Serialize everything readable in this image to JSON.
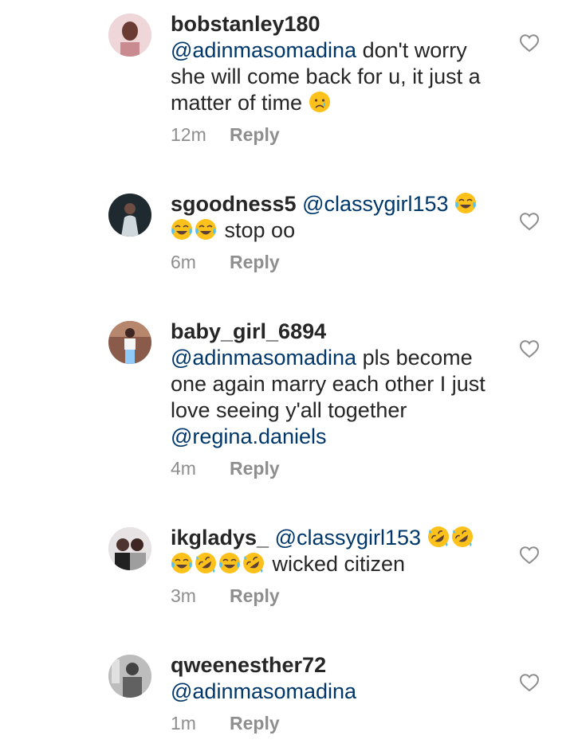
{
  "comments": [
    {
      "username": "bobstanley180",
      "mention": "@adinmasomadina",
      "text": "don't worry she will come back for u, it just a matter of time",
      "emoji_after": [
        "crying-face"
      ],
      "time": "12m",
      "reply_label": "Reply",
      "avatar_color": "#c98b8f"
    },
    {
      "username": "sgoodness5",
      "mention": "@classygirl153",
      "emoji_inline": [
        "tears-of-joy"
      ],
      "emoji_line2": [
        "tears-of-joy",
        "tears-of-joy"
      ],
      "text": "stop oo",
      "time": "6m",
      "reply_label": "Reply",
      "avatar_color": "#1e2a2f"
    },
    {
      "username": "baby_girl_6894",
      "mention": "@adinmasomadina",
      "text": "pls become one again marry each other I just love seeing y'all together",
      "mention2": "@regina.daniels",
      "time": "4m",
      "reply_label": "Reply",
      "avatar_color": "#8a5a4a"
    },
    {
      "username": "ikgladys_",
      "mention": "@classygirl153",
      "emoji_inline": [
        "rolling-laughing",
        "rolling-laughing"
      ],
      "emoji_line2": [
        "tears-of-joy",
        "rolling-laughing",
        "tears-of-joy",
        "rolling-laughing"
      ],
      "text": "wicked citizen",
      "time": "3m",
      "reply_label": "Reply",
      "avatar_color": "#b7b2b4"
    },
    {
      "username": "qweenesther72",
      "mention": "@adinmasomadina",
      "time": "1m",
      "reply_label": "Reply",
      "avatar_color": "#8c8c8c"
    }
  ],
  "colors": {
    "text": "#262626",
    "mention": "#00376b",
    "meta": "#8e8e8e",
    "emoji_face": "#fcc21b"
  },
  "icons": {
    "like": "heart-outline-icon"
  }
}
